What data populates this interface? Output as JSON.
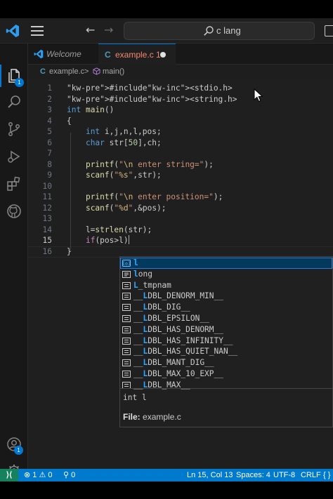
{
  "search": {
    "text": "c lang"
  },
  "tabs": [
    {
      "label": "Welcome"
    },
    {
      "icon": "C",
      "label": "example.c 1"
    }
  ],
  "breadcrumb": {
    "lang_icon": "C",
    "file": "example.c",
    "separator": ">",
    "symbol": "main()"
  },
  "activity": {
    "accounts_badge": "1"
  },
  "line_numbers": [
    "1",
    "2",
    "3",
    "4",
    "5",
    "6",
    "7",
    "8",
    "9",
    "10",
    "11",
    "12",
    "13",
    "14",
    "15",
    "16"
  ],
  "code_lines": [
    "#include<stdio.h>",
    "#include<string.h>",
    "int main()",
    "{",
    "    int i,j,n,l,pos;",
    "    char str[50],ch;",
    "",
    "    printf(\"\\n enter string=\");",
    "    scanf(\"%s\",str);",
    "",
    "    printf(\"\\n enter position=\");",
    "    scanf(\"%d\",&pos);",
    "",
    "    l=strlen(str);",
    "    if(pos>l)",
    "}"
  ],
  "suggestions": [
    {
      "label": "l",
      "highlight": "l",
      "icon": "variable-icon"
    },
    {
      "label": "long",
      "highlight": "l",
      "icon": "keyword-icon"
    },
    {
      "label": "L_tmpnam",
      "highlight": "L",
      "icon": "constant-icon"
    },
    {
      "label": "__LDBL_DENORM_MIN__",
      "highlight": "L",
      "icon": "constant-icon"
    },
    {
      "label": "__LDBL_DIG__",
      "highlight": "L",
      "icon": "constant-icon"
    },
    {
      "label": "__LDBL_EPSILON__",
      "highlight": "L",
      "icon": "constant-icon"
    },
    {
      "label": "__LDBL_HAS_DENORM__",
      "highlight": "L",
      "icon": "constant-icon"
    },
    {
      "label": "__LDBL_HAS_INFINITY__",
      "highlight": "L",
      "icon": "constant-icon"
    },
    {
      "label": "__LDBL_HAS_QUIET_NAN__",
      "highlight": "L",
      "icon": "constant-icon"
    },
    {
      "label": "__LDBL_MANT_DIG__",
      "highlight": "L",
      "icon": "constant-icon"
    },
    {
      "label": "__LDBL_MAX_10_EXP__",
      "highlight": "L",
      "icon": "constant-icon"
    },
    {
      "label": "__LDBL_MAX__",
      "highlight": "L",
      "icon": "constant-icon"
    }
  ],
  "suggest_detail": {
    "signature": "int l",
    "file_label": "File:",
    "file_name": "example.c"
  },
  "status": {
    "remote": "⟩⟨",
    "errors": "1",
    "warnings": "0",
    "ports": "0",
    "position": "Ln 15, Col 13",
    "spaces": "Spaces: 4",
    "encoding": "UTF-8",
    "eol": "CRLF",
    "braces": "{ }"
  },
  "colors": {
    "accent": "#0078d4",
    "statusbar": "#007acc",
    "remote": "#16825d",
    "selection": "#04395e",
    "match": "#2aaaff"
  }
}
